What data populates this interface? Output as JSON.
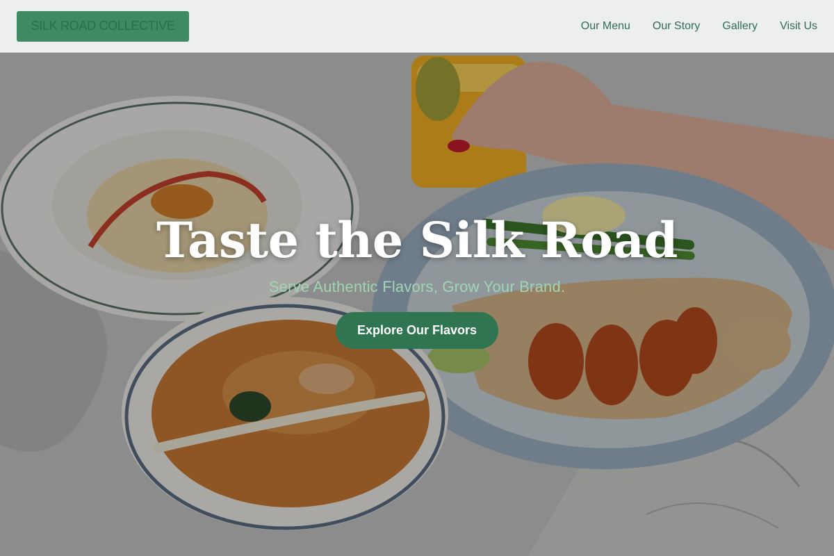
{
  "brand": {
    "name": "SILK ROAD COLLECTIVE"
  },
  "nav": {
    "items": [
      {
        "label": "Our Menu"
      },
      {
        "label": "Our Story"
      },
      {
        "label": "Gallery"
      },
      {
        "label": "Visit Us"
      }
    ]
  },
  "hero": {
    "headline": "Taste the Silk Road",
    "subheadline": "Serve Authentic Flavors, Grow Your Brand.",
    "cta_label": "Explore Our Flavors"
  },
  "colors": {
    "accent_green": "#2f7551",
    "brand_box_green": "#3f8a63",
    "nav_text": "#2f6d52",
    "subheadline_mint": "#9fd6b4"
  }
}
